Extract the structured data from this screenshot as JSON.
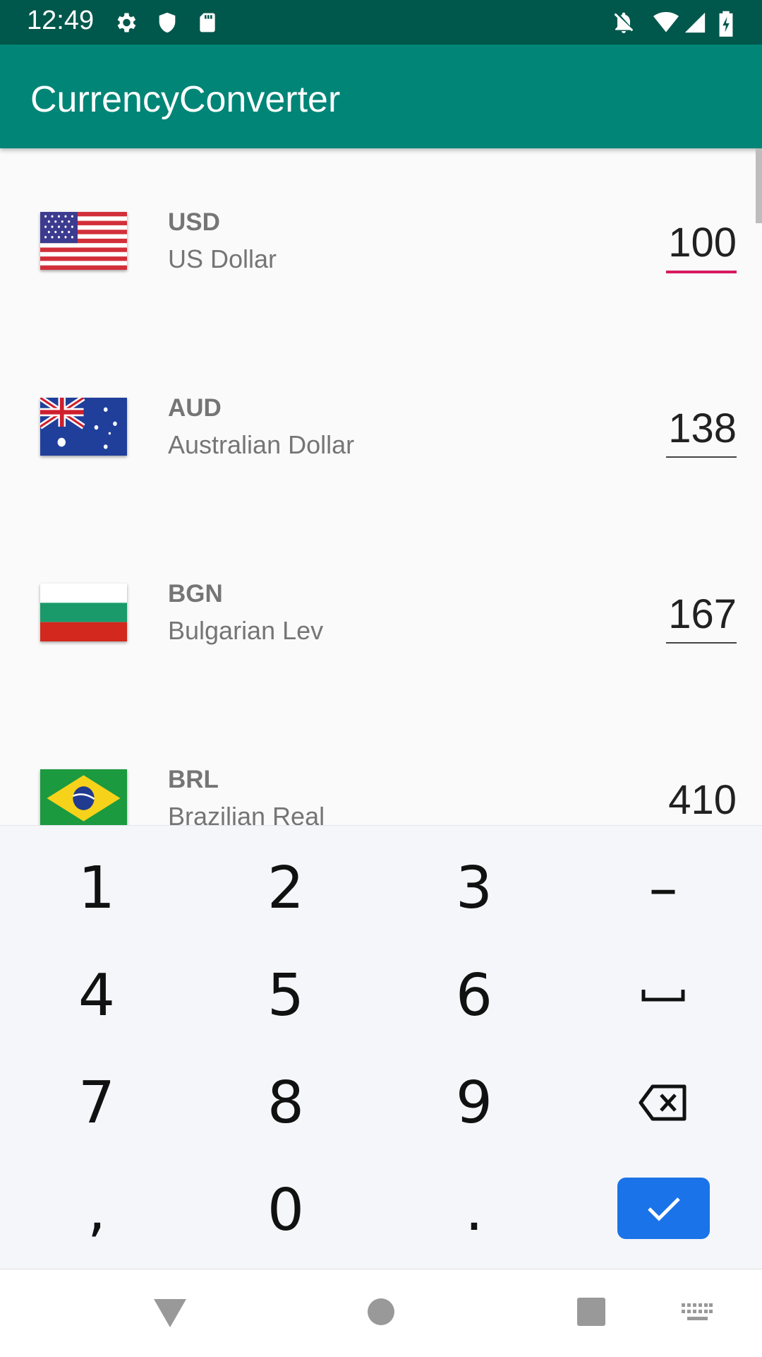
{
  "status_bar": {
    "time": "12:49",
    "left_icons": [
      "gear-icon",
      "shield-icon",
      "sd-card-icon"
    ],
    "right_icons": [
      "notifications-off-icon",
      "wifi-icon",
      "signal-icon",
      "battery-charging-icon"
    ]
  },
  "app_bar": {
    "title": "CurrencyConverter",
    "color": "#008577"
  },
  "currencies": [
    {
      "code": "USD",
      "name": "US Dollar",
      "amount": "100",
      "flag": "us-flag-icon",
      "focused": true
    },
    {
      "code": "AUD",
      "name": "Australian Dollar",
      "amount": "138",
      "flag": "australia-flag-icon",
      "focused": false
    },
    {
      "code": "BGN",
      "name": "Bulgarian Lev",
      "amount": "167",
      "flag": "bulgaria-flag-icon",
      "focused": false
    },
    {
      "code": "BRL",
      "name": "Brazilian Real",
      "amount": "410",
      "flag": "brazil-flag-icon",
      "focused": false
    }
  ],
  "keyboard": {
    "rows": [
      [
        "1",
        "2",
        "3",
        "–"
      ],
      [
        "4",
        "5",
        "6",
        "space-icon"
      ],
      [
        "7",
        "8",
        "9",
        "backspace-icon"
      ],
      [
        ",",
        "0",
        ".",
        "done-icon"
      ]
    ],
    "done_color": "#1a73e8"
  },
  "nav_bar": {
    "icons": [
      "back-icon",
      "home-icon",
      "recents-icon",
      "keyboard-switch-icon"
    ]
  }
}
